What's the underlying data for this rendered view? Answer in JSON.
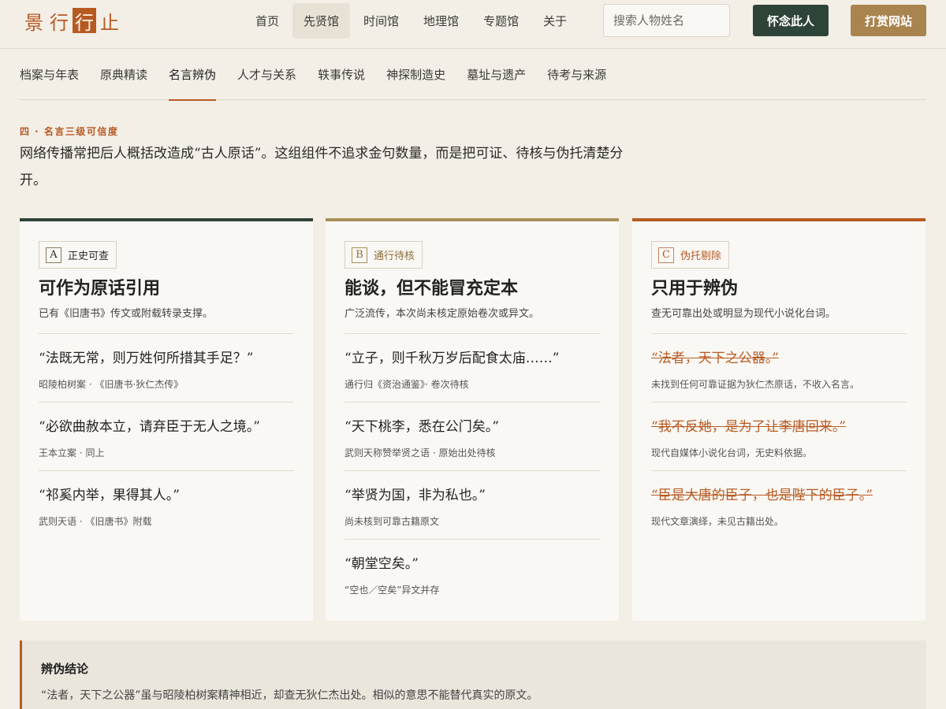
{
  "brand": {
    "logo_chars": [
      "景",
      "行",
      "行",
      "止"
    ]
  },
  "nav": {
    "items": [
      "首页",
      "先贤馆",
      "时间馆",
      "地理馆",
      "专题馆",
      "关于"
    ],
    "active_index": 1
  },
  "search": {
    "placeholder": "搜索人物姓名"
  },
  "buttons": {
    "remember": "怀念此人",
    "donate": "打赏网站"
  },
  "subtabs": {
    "items": [
      "档案与年表",
      "原典精读",
      "名言辨伪",
      "人才与关系",
      "轶事传说",
      "神探制造史",
      "墓址与遗产",
      "待考与来源"
    ],
    "active_index": 2
  },
  "section": {
    "kicker": "四 · 名言三级可信度",
    "intro": "网络传播常把后人概括改造成“古人原话”。这组组件不追求金句数量，而是把可证、待核与伪托清楚分开。"
  },
  "cards": [
    {
      "letter": "A",
      "tag": "正史可查",
      "heading": "可作为原话引用",
      "desc": "已有《旧唐书》传文或附载转录支撑。",
      "rows": [
        {
          "quote": "“法既无常，则万姓何所措其手足？”",
          "source": "昭陵柏树案 · 《旧唐书·狄仁杰传》"
        },
        {
          "quote": "“必欲曲赦本立，请弃臣于无人之境。”",
          "source": "王本立案 · 同上"
        },
        {
          "quote": "“祁奚内举，果得其人。”",
          "source": "武则天语 · 《旧唐书》附载"
        }
      ]
    },
    {
      "letter": "B",
      "tag": "通行待核",
      "heading": "能谈，但不能冒充定本",
      "desc": "广泛流传，本次尚未核定原始卷次或异文。",
      "rows": [
        {
          "quote": "“立子，则千秋万岁后配食太庙……”",
          "source": "通行归《资治通鉴》· 卷次待核"
        },
        {
          "quote": "“天下桃李，悉在公门矣。”",
          "source": "武则天称赞举贤之语 · 原始出处待核"
        },
        {
          "quote": "“举贤为国，非为私也。”",
          "source": "尚未核到可靠古籍原文"
        },
        {
          "quote": "“朝堂空矣。”",
          "source": "“空也／空矣”异文并存"
        }
      ]
    },
    {
      "letter": "C",
      "tag": "伪托剔除",
      "heading": "只用于辨伪",
      "desc": "查无可靠出处或明显为现代小说化台词。",
      "rows": [
        {
          "quote": "“法者，天下之公器。”",
          "source": "未找到任何可靠证据为狄仁杰原话，不收入名言。"
        },
        {
          "quote": "“我不反她，是为了让李唐回来。”",
          "source": "现代自媒体小说化台词，无史料依据。"
        },
        {
          "quote": "“臣是大唐的臣子，也是陛下的臣子。”",
          "source": "现代文章演绎，未见古籍出处。"
        }
      ]
    }
  ],
  "conclusion": {
    "title": "辨伪结论",
    "text": "“法者，天下之公器”虽与昭陵柏树案精神相近，却查无狄仁杰出处。相似的意思不能替代真实的原文。"
  },
  "colors": {
    "accent": "#b75a22",
    "dark_green": "#2f4438",
    "gold": "#a9844e",
    "background": "#f3efe7"
  }
}
